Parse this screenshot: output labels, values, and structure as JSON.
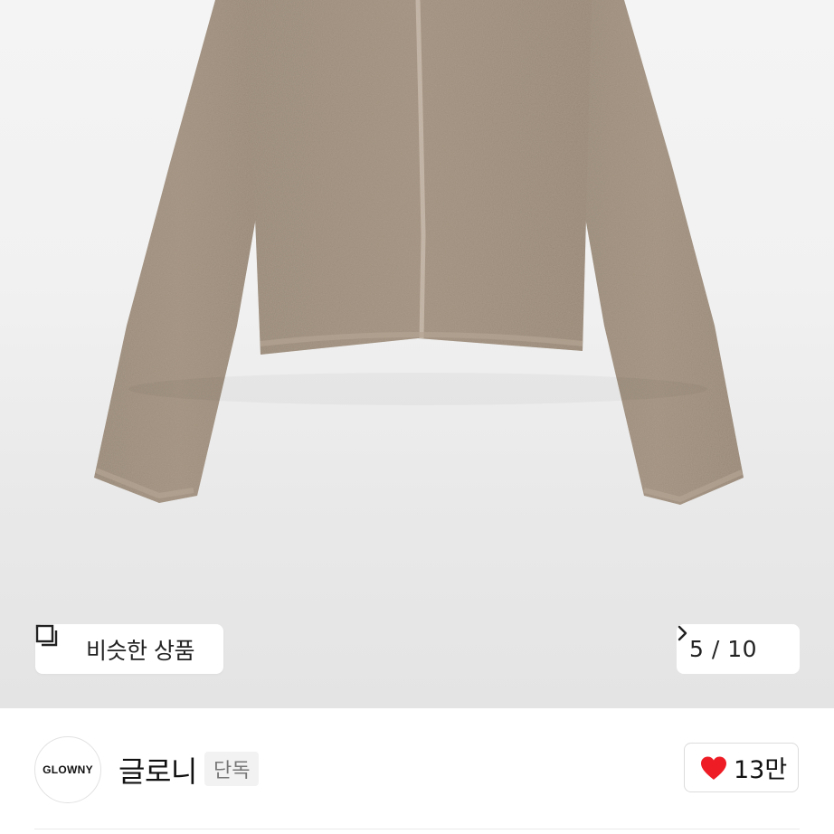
{
  "gallery": {
    "similar_label": "비슷한 상품",
    "counter": "5 / 10"
  },
  "brand": {
    "logo_text": "GLOWNY",
    "name": "글로니",
    "badge": "단독",
    "like_count": "13만"
  },
  "colors": {
    "heart": "#ee1c25",
    "knit": "#9b8a79"
  }
}
